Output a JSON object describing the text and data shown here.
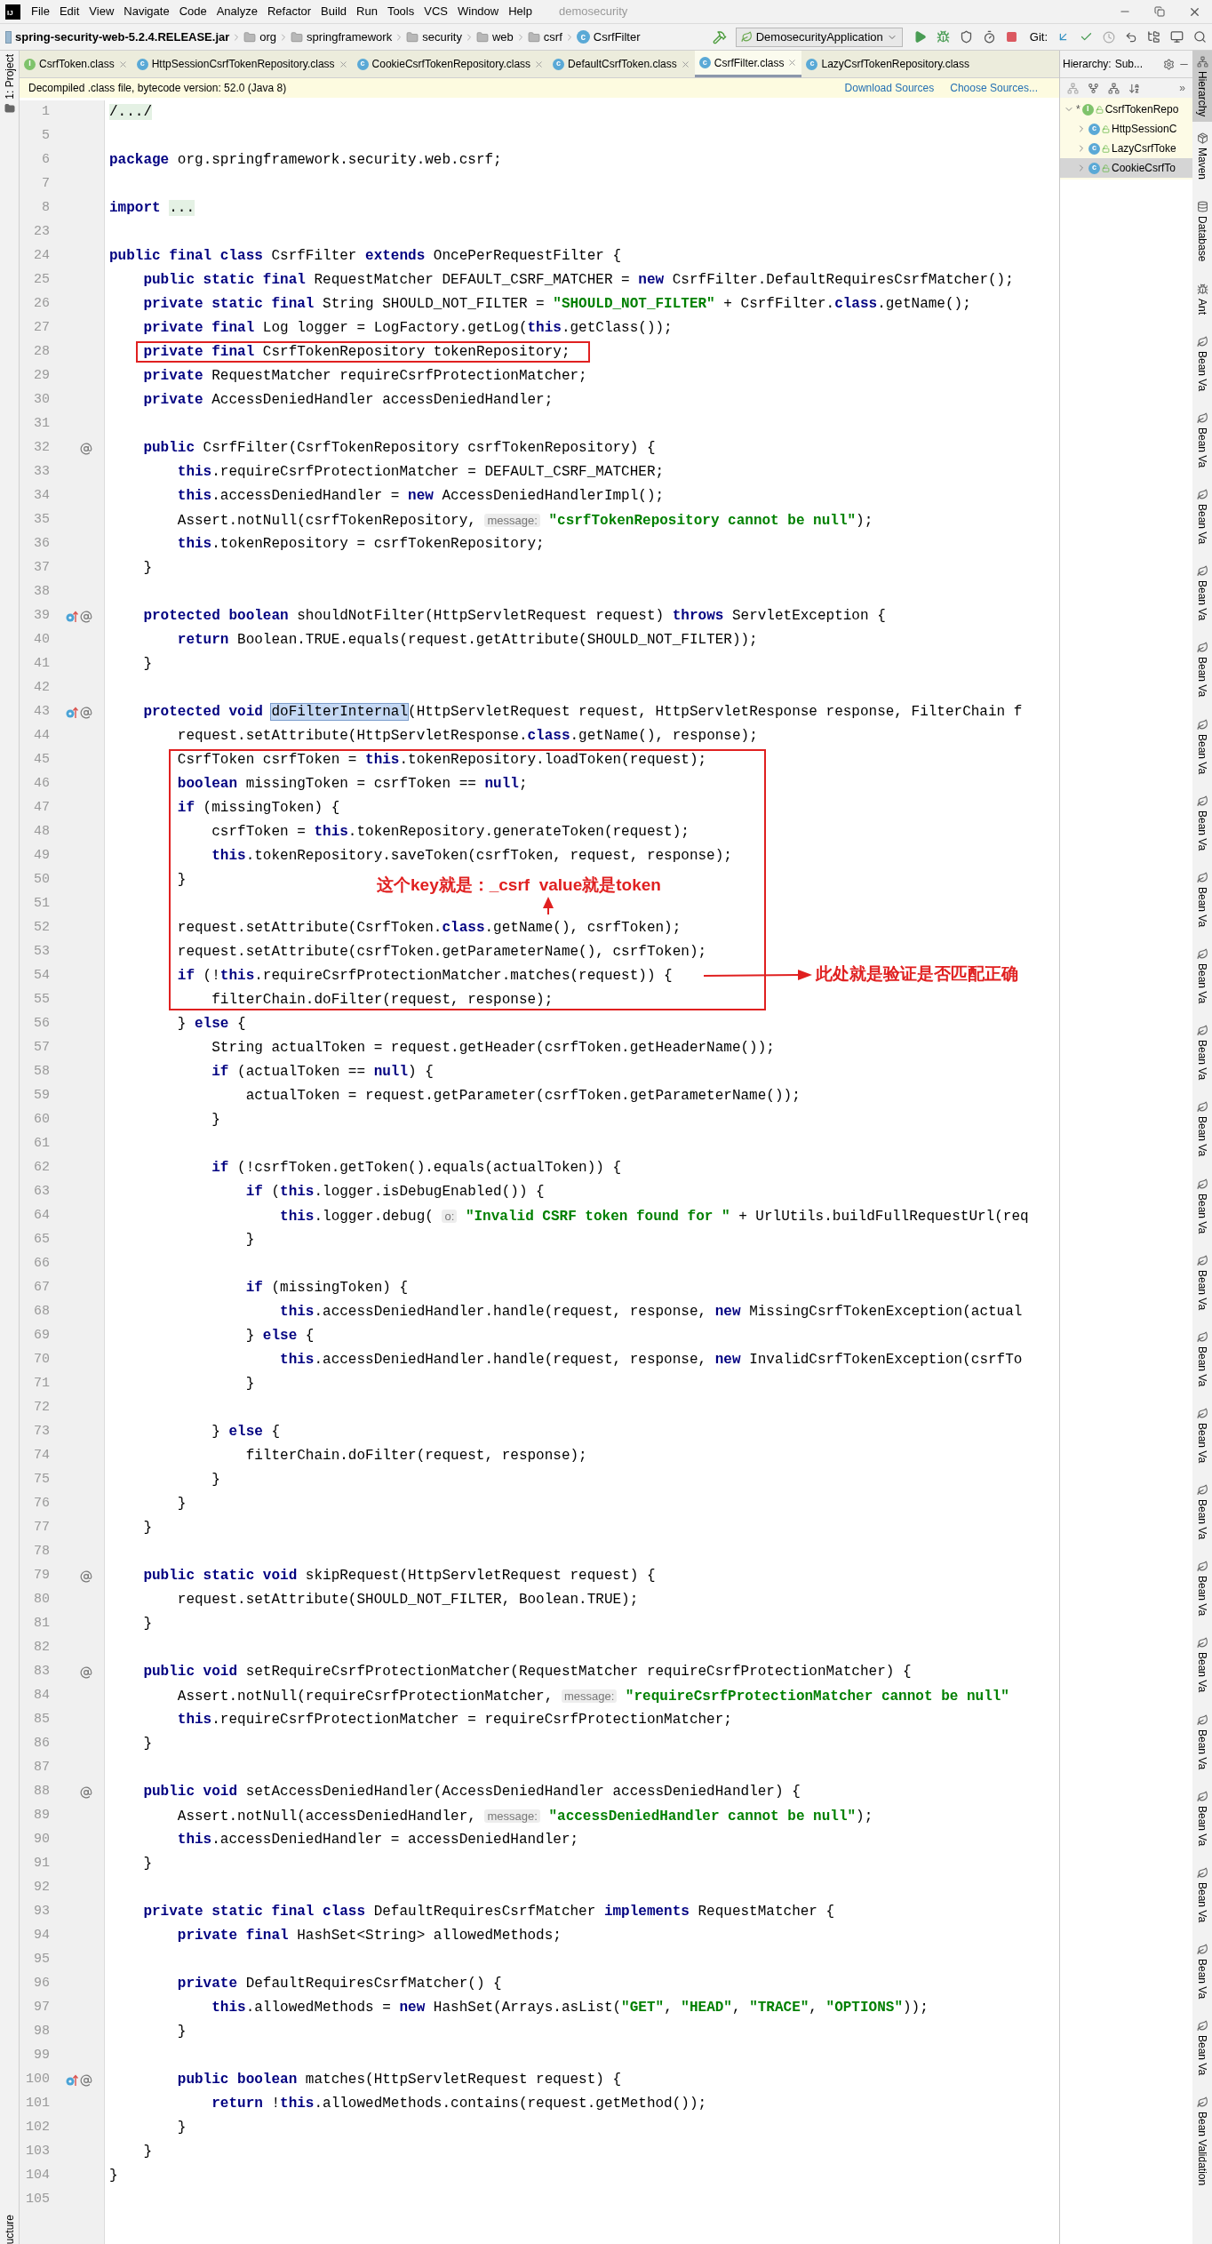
{
  "title_bar": {
    "logo_text": "IJ",
    "menus": [
      "File",
      "Edit",
      "View",
      "Navigate",
      "Code",
      "Analyze",
      "Refactor",
      "Build",
      "Run",
      "Tools",
      "VCS",
      "Window",
      "Help"
    ],
    "project": "demosecurity"
  },
  "nav_bar": {
    "breadcrumbs": [
      {
        "label": "spring-security-web-5.2.4.RELEASE.jar",
        "kind": "jar"
      },
      {
        "label": "org",
        "kind": "folder"
      },
      {
        "label": "springframework",
        "kind": "folder"
      },
      {
        "label": "security",
        "kind": "folder"
      },
      {
        "label": "web",
        "kind": "folder"
      },
      {
        "label": "csrf",
        "kind": "folder"
      },
      {
        "label": "CsrfFilter",
        "kind": "class",
        "icon_letter": "c"
      }
    ],
    "run_config": "DemosecurityApplication",
    "git_label": "Git:"
  },
  "left_strip": {
    "top": "1: Project",
    "bottom": "ucture"
  },
  "tabs": [
    {
      "label": "CsrfToken.class",
      "kind": "interface",
      "icon_letter": "I",
      "selected": false,
      "closable": true
    },
    {
      "label": "HttpSessionCsrfTokenRepository.class",
      "kind": "class",
      "icon_letter": "c",
      "selected": false,
      "closable": true
    },
    {
      "label": "CookieCsrfTokenRepository.class",
      "kind": "class",
      "icon_letter": "c",
      "selected": false,
      "closable": true
    },
    {
      "label": "DefaultCsrfToken.class",
      "kind": "class",
      "icon_letter": "c",
      "selected": false,
      "closable": true
    },
    {
      "label": "CsrfFilter.class",
      "kind": "class",
      "icon_letter": "c",
      "selected": true,
      "closable": true
    },
    {
      "label": "LazyCsrfTokenRepository.class",
      "kind": "class",
      "icon_letter": "c",
      "selected": false,
      "closable": false
    }
  ],
  "banner": {
    "text": "Decompiled .class file, bytecode version: 52.0 (Java 8)",
    "links": [
      "Download Sources",
      "Choose Sources..."
    ]
  },
  "hierarchy": {
    "title": "Hierarchy:",
    "scope": "Sub...",
    "overflow": "»",
    "tree": [
      {
        "label": "CsrfTokenRepo",
        "prefix": "*",
        "kind": "interface",
        "icon_letter": "I",
        "expanded": true,
        "selected": false,
        "children": [
          {
            "label": "HttpSessionC",
            "kind": "class",
            "icon_letter": "c",
            "expanded": false,
            "selected": false
          },
          {
            "label": "LazyCsrfToke",
            "kind": "class",
            "icon_letter": "c",
            "expanded": false,
            "selected": false
          },
          {
            "label": "CookieCsrfTo",
            "kind": "class",
            "icon_letter": "c",
            "expanded": false,
            "selected": true
          }
        ]
      }
    ]
  },
  "right_strip": [
    {
      "label": "Hierarchy",
      "kind": "hierarchy",
      "selected": true
    },
    {
      "label": "Maven",
      "kind": "maven",
      "selected": false
    },
    {
      "label": "Database",
      "kind": "database",
      "selected": false
    },
    {
      "label": "Ant",
      "kind": "ant",
      "selected": false
    },
    {
      "label": "Bean Va",
      "kind": "bean",
      "selected": false
    },
    {
      "label": "Bean Va",
      "kind": "bean",
      "selected": false
    },
    {
      "label": "Bean Va",
      "kind": "bean",
      "selected": false
    },
    {
      "label": "Bean Va",
      "kind": "bean",
      "selected": false
    },
    {
      "label": "Bean Va",
      "kind": "bean",
      "selected": false
    },
    {
      "label": "Bean Va",
      "kind": "bean",
      "selected": false
    },
    {
      "label": "Bean Va",
      "kind": "bean",
      "selected": false
    },
    {
      "label": "Bean Va",
      "kind": "bean",
      "selected": false
    },
    {
      "label": "Bean Va",
      "kind": "bean",
      "selected": false
    },
    {
      "label": "Bean Va",
      "kind": "bean",
      "selected": false
    },
    {
      "label": "Bean Va",
      "kind": "bean",
      "selected": false
    },
    {
      "label": "Bean Va",
      "kind": "bean",
      "selected": false
    },
    {
      "label": "Bean Va",
      "kind": "bean",
      "selected": false
    },
    {
      "label": "Bean Va",
      "kind": "bean",
      "selected": false
    },
    {
      "label": "Bean Va",
      "kind": "bean",
      "selected": false
    },
    {
      "label": "Bean Va",
      "kind": "bean",
      "selected": false
    },
    {
      "label": "Bean Va",
      "kind": "bean",
      "selected": false
    },
    {
      "label": "Bean Va",
      "kind": "bean",
      "selected": false
    },
    {
      "label": "Bean Va",
      "kind": "bean",
      "selected": false
    },
    {
      "label": "Bean Va",
      "kind": "bean",
      "selected": false
    },
    {
      "label": "Bean Va",
      "kind": "bean",
      "selected": false
    },
    {
      "label": "Bean Va",
      "kind": "bean",
      "selected": false
    },
    {
      "label": "Bean Va",
      "kind": "bean",
      "selected": false
    },
    {
      "label": "Bean Validation",
      "kind": "bean",
      "selected": false
    }
  ],
  "annotations": [
    "这个key就是：_csrf  value就是token",
    "此处就是验证是否匹配正确"
  ],
  "code": [
    {
      "num": "1",
      "tokens": [
        {
          "kind": "fold",
          "text": "/.../"
        }
      ]
    },
    {
      "num": "5"
    },
    {
      "num": "6",
      "tokens": [
        {
          "kind": "kw",
          "text": "package"
        },
        {
          "kind": "txt",
          "text": " org.springframework.security.web.csrf;"
        }
      ]
    },
    {
      "num": "7"
    },
    {
      "num": "8",
      "tokens": [
        {
          "kind": "kw",
          "text": "import "
        },
        {
          "kind": "fold",
          "text": "..."
        }
      ]
    },
    {
      "num": "23"
    },
    {
      "num": "24",
      "tokens": [
        {
          "kind": "kw",
          "text": "public final class"
        },
        {
          "kind": "txt",
          "text": " CsrfFilter "
        },
        {
          "kind": "kw",
          "text": "extends"
        },
        {
          "kind": "txt",
          "text": " OncePerRequestFilter {"
        }
      ]
    },
    {
      "num": "25",
      "tokens": [
        {
          "kind": "kw",
          "text": "    public static final"
        },
        {
          "kind": "txt",
          "text": " RequestMatcher DEFAULT_CSRF_MATCHER = "
        },
        {
          "kind": "kw",
          "text": "new"
        },
        {
          "kind": "txt",
          "text": " CsrfFilter.DefaultRequiresCsrfMatcher();"
        }
      ]
    },
    {
      "num": "26",
      "tokens": [
        {
          "kind": "kw",
          "text": "    private static final"
        },
        {
          "kind": "txt",
          "text": " String SHOULD_NOT_FILTER = "
        },
        {
          "kind": "str",
          "text": "\"SHOULD_NOT_FILTER\""
        },
        {
          "kind": "txt",
          "text": " + CsrfFilter."
        },
        {
          "kind": "kw",
          "text": "class"
        },
        {
          "kind": "txt",
          "text": ".getName();"
        }
      ]
    },
    {
      "num": "27",
      "tokens": [
        {
          "kind": "kw",
          "text": "    private final"
        },
        {
          "kind": "txt",
          "text": " Log logger = LogFactory.getLog("
        },
        {
          "kind": "kw",
          "text": "this"
        },
        {
          "kind": "txt",
          "text": ".getClass());"
        }
      ]
    },
    {
      "num": "28",
      "boxed": true,
      "tokens": [
        {
          "kind": "kw",
          "text": "    private final"
        },
        {
          "kind": "txt",
          "text": " CsrfTokenRepository tokenRepository;"
        }
      ]
    },
    {
      "num": "29",
      "tokens": [
        {
          "kind": "kw",
          "text": "    private"
        },
        {
          "kind": "txt",
          "text": " RequestMatcher requireCsrfProtectionMatcher;"
        }
      ]
    },
    {
      "num": "30",
      "tokens": [
        {
          "kind": "kw",
          "text": "    private"
        },
        {
          "kind": "txt",
          "text": " AccessDeniedHandler accessDeniedHandler;"
        }
      ]
    },
    {
      "num": "31"
    },
    {
      "num": "32",
      "kind": "annotated",
      "tokens": [
        {
          "kind": "kw",
          "text": "    public"
        },
        {
          "kind": "txt",
          "text": " CsrfFilter(CsrfTokenRepository csrfTokenRepository) {"
        }
      ]
    },
    {
      "num": "33",
      "tokens": [
        {
          "kind": "kw",
          "text": "        this"
        },
        {
          "kind": "txt",
          "text": ".requireCsrfProtectionMatcher = DEFAULT_CSRF_MATCHER;"
        }
      ]
    },
    {
      "num": "34",
      "tokens": [
        {
          "kind": "kw",
          "text": "        this"
        },
        {
          "kind": "txt",
          "text": ".accessDeniedHandler = "
        },
        {
          "kind": "kw",
          "text": "new"
        },
        {
          "kind": "txt",
          "text": " AccessDeniedHandlerImpl();"
        }
      ]
    },
    {
      "num": "35",
      "tokens": [
        {
          "kind": "txt",
          "text": "        Assert.notNull(csrfTokenRepository, "
        },
        {
          "kind": "hint",
          "text": "message:"
        },
        {
          "kind": "str",
          "text": " \"csrfTokenRepository cannot be null\""
        },
        {
          "kind": "txt",
          "text": ");"
        }
      ]
    },
    {
      "num": "36",
      "tokens": [
        {
          "kind": "kw",
          "text": "        this"
        },
        {
          "kind": "txt",
          "text": ".tokenRepository = csrfTokenRepository;"
        }
      ]
    },
    {
      "num": "37",
      "tokens": [
        {
          "kind": "txt",
          "text": "    }"
        }
      ]
    },
    {
      "num": "38"
    },
    {
      "num": "39",
      "kind": "override",
      "tokens": [
        {
          "kind": "kw",
          "text": "    protected boolean"
        },
        {
          "kind": "txt",
          "text": " shouldNotFilter(HttpServletRequest request) "
        },
        {
          "kind": "kw",
          "text": "throws"
        },
        {
          "kind": "txt",
          "text": " ServletException {"
        }
      ]
    },
    {
      "num": "40",
      "tokens": [
        {
          "kind": "kw",
          "text": "        return"
        },
        {
          "kind": "txt",
          "text": " Boolean.TRUE.equals(request.getAttribute(SHOULD_NOT_FILTER));"
        }
      ]
    },
    {
      "num": "41",
      "tokens": [
        {
          "kind": "txt",
          "text": "    }"
        }
      ]
    },
    {
      "num": "42"
    },
    {
      "num": "43",
      "kind": "override",
      "tokens": [
        {
          "kind": "kw",
          "text": "    protected void "
        },
        {
          "kind": "sel",
          "text": "doFilterInternal"
        },
        {
          "kind": "txt",
          "text": "(HttpServletRequest request, HttpServletResponse response, FilterChain f"
        }
      ]
    },
    {
      "num": "44",
      "tokens": [
        {
          "kind": "txt",
          "text": "        request.setAttribute(HttpServletResponse."
        },
        {
          "kind": "kw",
          "text": "class"
        },
        {
          "kind": "txt",
          "text": ".getName(), response);"
        }
      ]
    },
    {
      "kind": "boxed_block",
      "lines": [
        {
          "num": "45",
          "tokens": [
            {
              "kind": "txt",
              "text": "        CsrfToken csrfToken = "
            },
            {
              "kind": "kw",
              "text": "this"
            },
            {
              "kind": "txt",
              "text": ".tokenRepository.loadToken(request);"
            }
          ]
        },
        {
          "num": "46",
          "tokens": [
            {
              "kind": "kw",
              "text": "        boolean"
            },
            {
              "kind": "txt",
              "text": " missingToken = csrfToken == "
            },
            {
              "kind": "kw",
              "text": "null"
            },
            {
              "kind": "txt",
              "text": ";"
            }
          ]
        },
        {
          "num": "47",
          "tokens": [
            {
              "kind": "kw",
              "text": "        if"
            },
            {
              "kind": "txt",
              "text": " (missingToken) {"
            }
          ]
        },
        {
          "num": "48",
          "tokens": [
            {
              "kind": "txt",
              "text": "            csrfToken = "
            },
            {
              "kind": "kw",
              "text": "this"
            },
            {
              "kind": "txt",
              "text": ".tokenRepository.generateToken(request);"
            }
          ]
        },
        {
          "num": "49",
          "tokens": [
            {
              "kind": "kw",
              "text": "            this"
            },
            {
              "kind": "txt",
              "text": ".tokenRepository.saveToken(csrfToken, request, response);"
            }
          ]
        },
        {
          "num": "50",
          "tokens": [
            {
              "kind": "txt",
              "text": "        }"
            }
          ]
        },
        {
          "num": "51"
        },
        {
          "num": "52",
          "tokens": [
            {
              "kind": "txt",
              "text": "        request.setAttribute(CsrfToken."
            },
            {
              "kind": "kw",
              "text": "class"
            },
            {
              "kind": "txt",
              "text": ".getName(), csrfToken);"
            }
          ]
        },
        {
          "num": "53",
          "tokens": [
            {
              "kind": "txt",
              "text": "        request.setAttribute(csrfToken.getParameterName(), csrfToken);"
            }
          ]
        },
        {
          "num": "54",
          "tokens": [
            {
              "kind": "kw",
              "text": "        if"
            },
            {
              "kind": "txt",
              "text": " (!"
            },
            {
              "kind": "kw",
              "text": "this"
            },
            {
              "kind": "txt",
              "text": ".requireCsrfProtectionMatcher.matches(request)) {"
            }
          ]
        },
        {
          "num": "55",
          "tokens": [
            {
              "kind": "txt",
              "text": "            filterChain.doFilter(request, response);"
            }
          ]
        }
      ]
    },
    {
      "num": "56",
      "tokens": [
        {
          "kind": "txt",
          "text": "        } "
        },
        {
          "kind": "kw",
          "text": "else"
        },
        {
          "kind": "txt",
          "text": " {"
        }
      ]
    },
    {
      "num": "57",
      "tokens": [
        {
          "kind": "txt",
          "text": "            String actualToken = request.getHeader(csrfToken.getHeaderName());"
        }
      ]
    },
    {
      "num": "58",
      "tokens": [
        {
          "kind": "kw",
          "text": "            if"
        },
        {
          "kind": "txt",
          "text": " (actualToken == "
        },
        {
          "kind": "kw",
          "text": "null"
        },
        {
          "kind": "txt",
          "text": ") {"
        }
      ]
    },
    {
      "num": "59",
      "tokens": [
        {
          "kind": "txt",
          "text": "                actualToken = request.getParameter(csrfToken.getParameterName());"
        }
      ]
    },
    {
      "num": "60",
      "tokens": [
        {
          "kind": "txt",
          "text": "            }"
        }
      ]
    },
    {
      "num": "61"
    },
    {
      "num": "62",
      "tokens": [
        {
          "kind": "kw",
          "text": "            if"
        },
        {
          "kind": "txt",
          "text": " (!csrfToken.getToken().equals(actualToken)) {"
        }
      ]
    },
    {
      "num": "63",
      "tokens": [
        {
          "kind": "kw",
          "text": "                if"
        },
        {
          "kind": "txt",
          "text": " ("
        },
        {
          "kind": "kw",
          "text": "this"
        },
        {
          "kind": "txt",
          "text": ".logger.isDebugEnabled()) {"
        }
      ]
    },
    {
      "num": "64",
      "tokens": [
        {
          "kind": "kw",
          "text": "                    this"
        },
        {
          "kind": "txt",
          "text": ".logger.debug( "
        },
        {
          "kind": "hint",
          "text": "o:"
        },
        {
          "kind": "str",
          "text": " \"Invalid CSRF token found for \""
        },
        {
          "kind": "txt",
          "text": " + UrlUtils.buildFullRequestUrl(req"
        }
      ]
    },
    {
      "num": "65",
      "tokens": [
        {
          "kind": "txt",
          "text": "                }"
        }
      ]
    },
    {
      "num": "66"
    },
    {
      "num": "67",
      "tokens": [
        {
          "kind": "kw",
          "text": "                if"
        },
        {
          "kind": "txt",
          "text": " (missingToken) {"
        }
      ]
    },
    {
      "num": "68",
      "tokens": [
        {
          "kind": "kw",
          "text": "                    this"
        },
        {
          "kind": "txt",
          "text": ".accessDeniedHandler.handle(request, response, "
        },
        {
          "kind": "kw",
          "text": "new"
        },
        {
          "kind": "txt",
          "text": " MissingCsrfTokenException(actual"
        }
      ]
    },
    {
      "num": "69",
      "tokens": [
        {
          "kind": "txt",
          "text": "                } "
        },
        {
          "kind": "kw",
          "text": "else"
        },
        {
          "kind": "txt",
          "text": " {"
        }
      ]
    },
    {
      "num": "70",
      "tokens": [
        {
          "kind": "kw",
          "text": "                    this"
        },
        {
          "kind": "txt",
          "text": ".accessDeniedHandler.handle(request, response, "
        },
        {
          "kind": "kw",
          "text": "new"
        },
        {
          "kind": "txt",
          "text": " InvalidCsrfTokenException(csrfTo"
        }
      ]
    },
    {
      "num": "71",
      "tokens": [
        {
          "kind": "txt",
          "text": "                }"
        }
      ]
    },
    {
      "num": "72"
    },
    {
      "num": "73",
      "tokens": [
        {
          "kind": "txt",
          "text": "            } "
        },
        {
          "kind": "kw",
          "text": "else"
        },
        {
          "kind": "txt",
          "text": " {"
        }
      ]
    },
    {
      "num": "74",
      "tokens": [
        {
          "kind": "txt",
          "text": "                filterChain.doFilter(request, response);"
        }
      ]
    },
    {
      "num": "75",
      "tokens": [
        {
          "kind": "txt",
          "text": "            }"
        }
      ]
    },
    {
      "num": "76",
      "tokens": [
        {
          "kind": "txt",
          "text": "        }"
        }
      ]
    },
    {
      "num": "77",
      "tokens": [
        {
          "kind": "txt",
          "text": "    }"
        }
      ]
    },
    {
      "num": "78"
    },
    {
      "num": "79",
      "kind": "annotated",
      "tokens": [
        {
          "kind": "kw",
          "text": "    public static void"
        },
        {
          "kind": "txt",
          "text": " skipRequest(HttpServletRequest request) {"
        }
      ]
    },
    {
      "num": "80",
      "tokens": [
        {
          "kind": "txt",
          "text": "        request.setAttribute(SHOULD_NOT_FILTER, Boolean.TRUE);"
        }
      ]
    },
    {
      "num": "81",
      "tokens": [
        {
          "kind": "txt",
          "text": "    }"
        }
      ]
    },
    {
      "num": "82"
    },
    {
      "num": "83",
      "kind": "annotated",
      "tokens": [
        {
          "kind": "kw",
          "text": "    public void"
        },
        {
          "kind": "txt",
          "text": " setRequireCsrfProtectionMatcher(RequestMatcher requireCsrfProtectionMatcher) {"
        }
      ]
    },
    {
      "num": "84",
      "tokens": [
        {
          "kind": "txt",
          "text": "        Assert.notNull(requireCsrfProtectionMatcher, "
        },
        {
          "kind": "hint",
          "text": "message:"
        },
        {
          "kind": "str",
          "text": " \"requireCsrfProtectionMatcher cannot be null\""
        }
      ]
    },
    {
      "num": "85",
      "tokens": [
        {
          "kind": "kw",
          "text": "        this"
        },
        {
          "kind": "txt",
          "text": ".requireCsrfProtectionMatcher = requireCsrfProtectionMatcher;"
        }
      ]
    },
    {
      "num": "86",
      "tokens": [
        {
          "kind": "txt",
          "text": "    }"
        }
      ]
    },
    {
      "num": "87"
    },
    {
      "num": "88",
      "kind": "annotated",
      "tokens": [
        {
          "kind": "kw",
          "text": "    public void"
        },
        {
          "kind": "txt",
          "text": " setAccessDeniedHandler(AccessDeniedHandler accessDeniedHandler) {"
        }
      ]
    },
    {
      "num": "89",
      "tokens": [
        {
          "kind": "txt",
          "text": "        Assert.notNull(accessDeniedHandler, "
        },
        {
          "kind": "hint",
          "text": "message:"
        },
        {
          "kind": "str",
          "text": " \"accessDeniedHandler cannot be null\""
        },
        {
          "kind": "txt",
          "text": ");"
        }
      ]
    },
    {
      "num": "90",
      "tokens": [
        {
          "kind": "kw",
          "text": "        this"
        },
        {
          "kind": "txt",
          "text": ".accessDeniedHandler = accessDeniedHandler;"
        }
      ]
    },
    {
      "num": "91",
      "tokens": [
        {
          "kind": "txt",
          "text": "    }"
        }
      ]
    },
    {
      "num": "92"
    },
    {
      "num": "93",
      "tokens": [
        {
          "kind": "kw",
          "text": "    private static final class"
        },
        {
          "kind": "txt",
          "text": " DefaultRequiresCsrfMatcher "
        },
        {
          "kind": "kw",
          "text": "implements"
        },
        {
          "kind": "txt",
          "text": " RequestMatcher {"
        }
      ]
    },
    {
      "num": "94",
      "tokens": [
        {
          "kind": "kw",
          "text": "        private final"
        },
        {
          "kind": "txt",
          "text": " HashSet<String> allowedMethods;"
        }
      ]
    },
    {
      "num": "95"
    },
    {
      "num": "96",
      "tokens": [
        {
          "kind": "kw",
          "text": "        private"
        },
        {
          "kind": "txt",
          "text": " DefaultRequiresCsrfMatcher() {"
        }
      ]
    },
    {
      "num": "97",
      "tokens": [
        {
          "kind": "kw",
          "text": "            this"
        },
        {
          "kind": "txt",
          "text": ".allowedMethods = "
        },
        {
          "kind": "kw",
          "text": "new"
        },
        {
          "kind": "txt",
          "text": " HashSet(Arrays.asList("
        },
        {
          "kind": "str",
          "text": "\"GET\""
        },
        {
          "kind": "txt",
          "text": ", "
        },
        {
          "kind": "str",
          "text": "\"HEAD\""
        },
        {
          "kind": "txt",
          "text": ", "
        },
        {
          "kind": "str",
          "text": "\"TRACE\""
        },
        {
          "kind": "txt",
          "text": ", "
        },
        {
          "kind": "str",
          "text": "\"OPTIONS\""
        },
        {
          "kind": "txt",
          "text": "));"
        }
      ]
    },
    {
      "num": "98",
      "tokens": [
        {
          "kind": "txt",
          "text": "        }"
        }
      ]
    },
    {
      "num": "99"
    },
    {
      "num": "100",
      "kind": "override",
      "tokens": [
        {
          "kind": "kw",
          "text": "        public boolean"
        },
        {
          "kind": "txt",
          "text": " matches(HttpServletRequest request) {"
        }
      ]
    },
    {
      "num": "101",
      "tokens": [
        {
          "kind": "kw",
          "text": "            return"
        },
        {
          "kind": "txt",
          "text": " !"
        },
        {
          "kind": "kw",
          "text": "this"
        },
        {
          "kind": "txt",
          "text": ".allowedMethods.contains(request.getMethod());"
        }
      ]
    },
    {
      "num": "102",
      "tokens": [
        {
          "kind": "txt",
          "text": "        }"
        }
      ]
    },
    {
      "num": "103",
      "tokens": [
        {
          "kind": "txt",
          "text": "    }"
        }
      ]
    },
    {
      "num": "104",
      "tokens": [
        {
          "kind": "txt",
          "text": "}"
        }
      ]
    },
    {
      "num": "105"
    }
  ]
}
